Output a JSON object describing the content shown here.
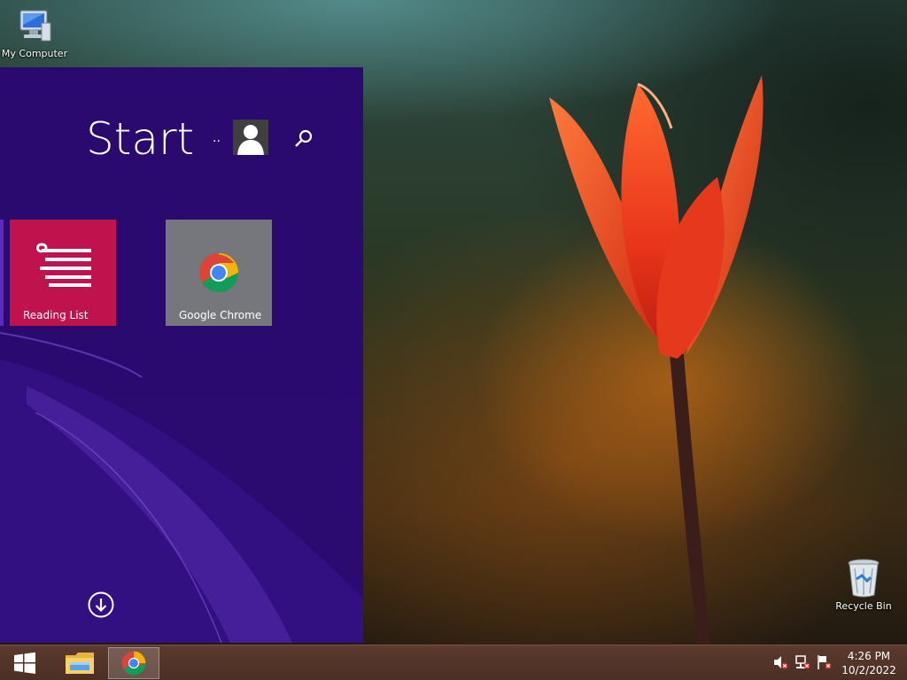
{
  "desktop": {
    "icons": [
      {
        "label": "My Computer",
        "icon": "computer-icon"
      },
      {
        "label": "Recycle Bin",
        "icon": "recycle-bin-icon"
      }
    ]
  },
  "start_screen": {
    "title": "Start",
    "user_name": "..",
    "avatar_icon": "user-avatar-icon",
    "search_icon": "search-icon",
    "tiles": [
      {
        "label": "Reading List",
        "icon": "reading-list-icon",
        "color": "#c0124c"
      },
      {
        "label": "Google Chrome",
        "icon": "chrome-icon",
        "color": "#76777d"
      }
    ],
    "apps_button_icon": "arrow-down-circle-icon",
    "accent": "#2a0a6e"
  },
  "taskbar": {
    "buttons": [
      {
        "name": "start",
        "icon": "windows-logo-icon"
      },
      {
        "name": "file-explorer",
        "icon": "folder-icon"
      },
      {
        "name": "google-chrome",
        "icon": "chrome-icon"
      }
    ],
    "tray": [
      "volume-muted-icon",
      "network-icon",
      "action-center-flag-icon"
    ],
    "time": "4:26 PM",
    "date": "10/2/2022"
  }
}
